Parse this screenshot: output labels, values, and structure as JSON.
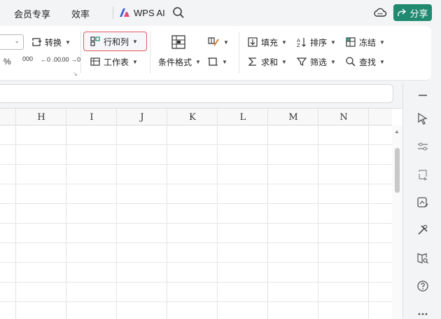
{
  "topbar": {
    "menu_member": "会员专享",
    "menu_efficiency": "效率",
    "wps_ai_label": "WPS AI",
    "share_label": "分享",
    "colors": {
      "share_bg": "#1f8a70",
      "ai_logo": "#3b5bdb"
    }
  },
  "ribbon": {
    "convert": "转换",
    "rows_cols": "行和列",
    "worksheet": "工作表",
    "cond_format": "条件格式",
    "fill": "填充",
    "sort": "排序",
    "freeze": "冻结",
    "sum": "求和",
    "filter": "筛选",
    "find": "查找",
    "num_percent": "%",
    "num_thousand": "000",
    "num_dec_inc": "←0 .00",
    "num_dec_dec": ".00 →0",
    "highlight_color": "#e05a5a"
  },
  "sheet": {
    "columns": [
      "H",
      "I",
      "J",
      "K",
      "L",
      "M",
      "N"
    ]
  },
  "right_panel": {
    "icons": [
      "collapse-icon",
      "select-cursor-icon",
      "sliders-icon",
      "rotate-icon",
      "chart-edit-icon",
      "tools-icon",
      "book-search-icon",
      "help-icon",
      "more-icon"
    ]
  }
}
